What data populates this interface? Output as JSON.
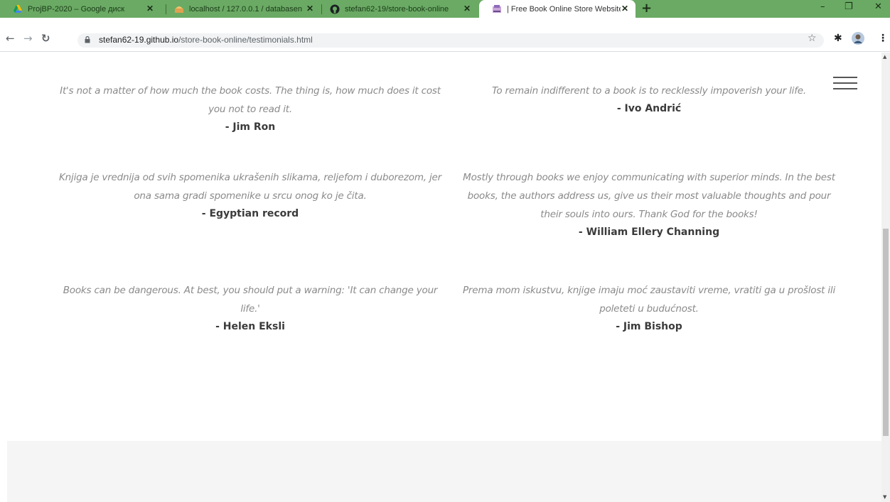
{
  "browser": {
    "tabs": [
      {
        "title": "ProjBP-2020 – Google диск",
        "icon": "google-drive-icon"
      },
      {
        "title": "localhost / 127.0.0.1 / databasen",
        "icon": "phpmyadmin-icon"
      },
      {
        "title": "stefan62-19/store-book-online",
        "icon": "github-icon"
      },
      {
        "title": "| Free Book Online Store Website",
        "icon": "site-favicon-icon"
      }
    ],
    "close_glyph": "✕",
    "new_tab_glyph": "+",
    "window_controls": {
      "minimize": "–",
      "maximize": "❐",
      "close": "✕"
    },
    "url": {
      "host": "stefan62-19.github.io",
      "path": "/store-book-online/testimonials.html"
    }
  },
  "testimonials": [
    {
      "text": "It's not a matter of how much the book costs. The thing is, how much does it cost you not to read it.",
      "author": "- Jim Ron"
    },
    {
      "text": "To remain indifferent to a book is to recklessly impoverish your life.",
      "author": "- Ivo Andrić"
    },
    {
      "text": "Knjiga je vrednija od svih spomenika ukrašenih slikama, reljefom i duborezom, jer ona sama gradi spomenike u srcu onog ko je čita.",
      "author": "- Egyptian record"
    },
    {
      "text": "Mostly through books we enjoy communicating with superior minds. In the best books, the authors address us, give us their most valuable thoughts and pour their souls into ours. Thank God for the books!",
      "author": "- William Ellery Channing"
    },
    {
      "text": "Books can be dangerous. At best, you should put a warning: 'It can change your life.'",
      "author": "- Helen Eksli"
    },
    {
      "text": "Prema mom iskustvu, knjige imaju moć zaustaviti vreme, vratiti ga u prošlost ili poleteti u budućnost.",
      "author": "- Jim Bishop"
    }
  ],
  "colors": {
    "tabstrip": "#6aaa64",
    "quote_text": "#8a8a8a",
    "author_text": "#3b3b3b",
    "footer_bg": "#f5f5f5"
  }
}
